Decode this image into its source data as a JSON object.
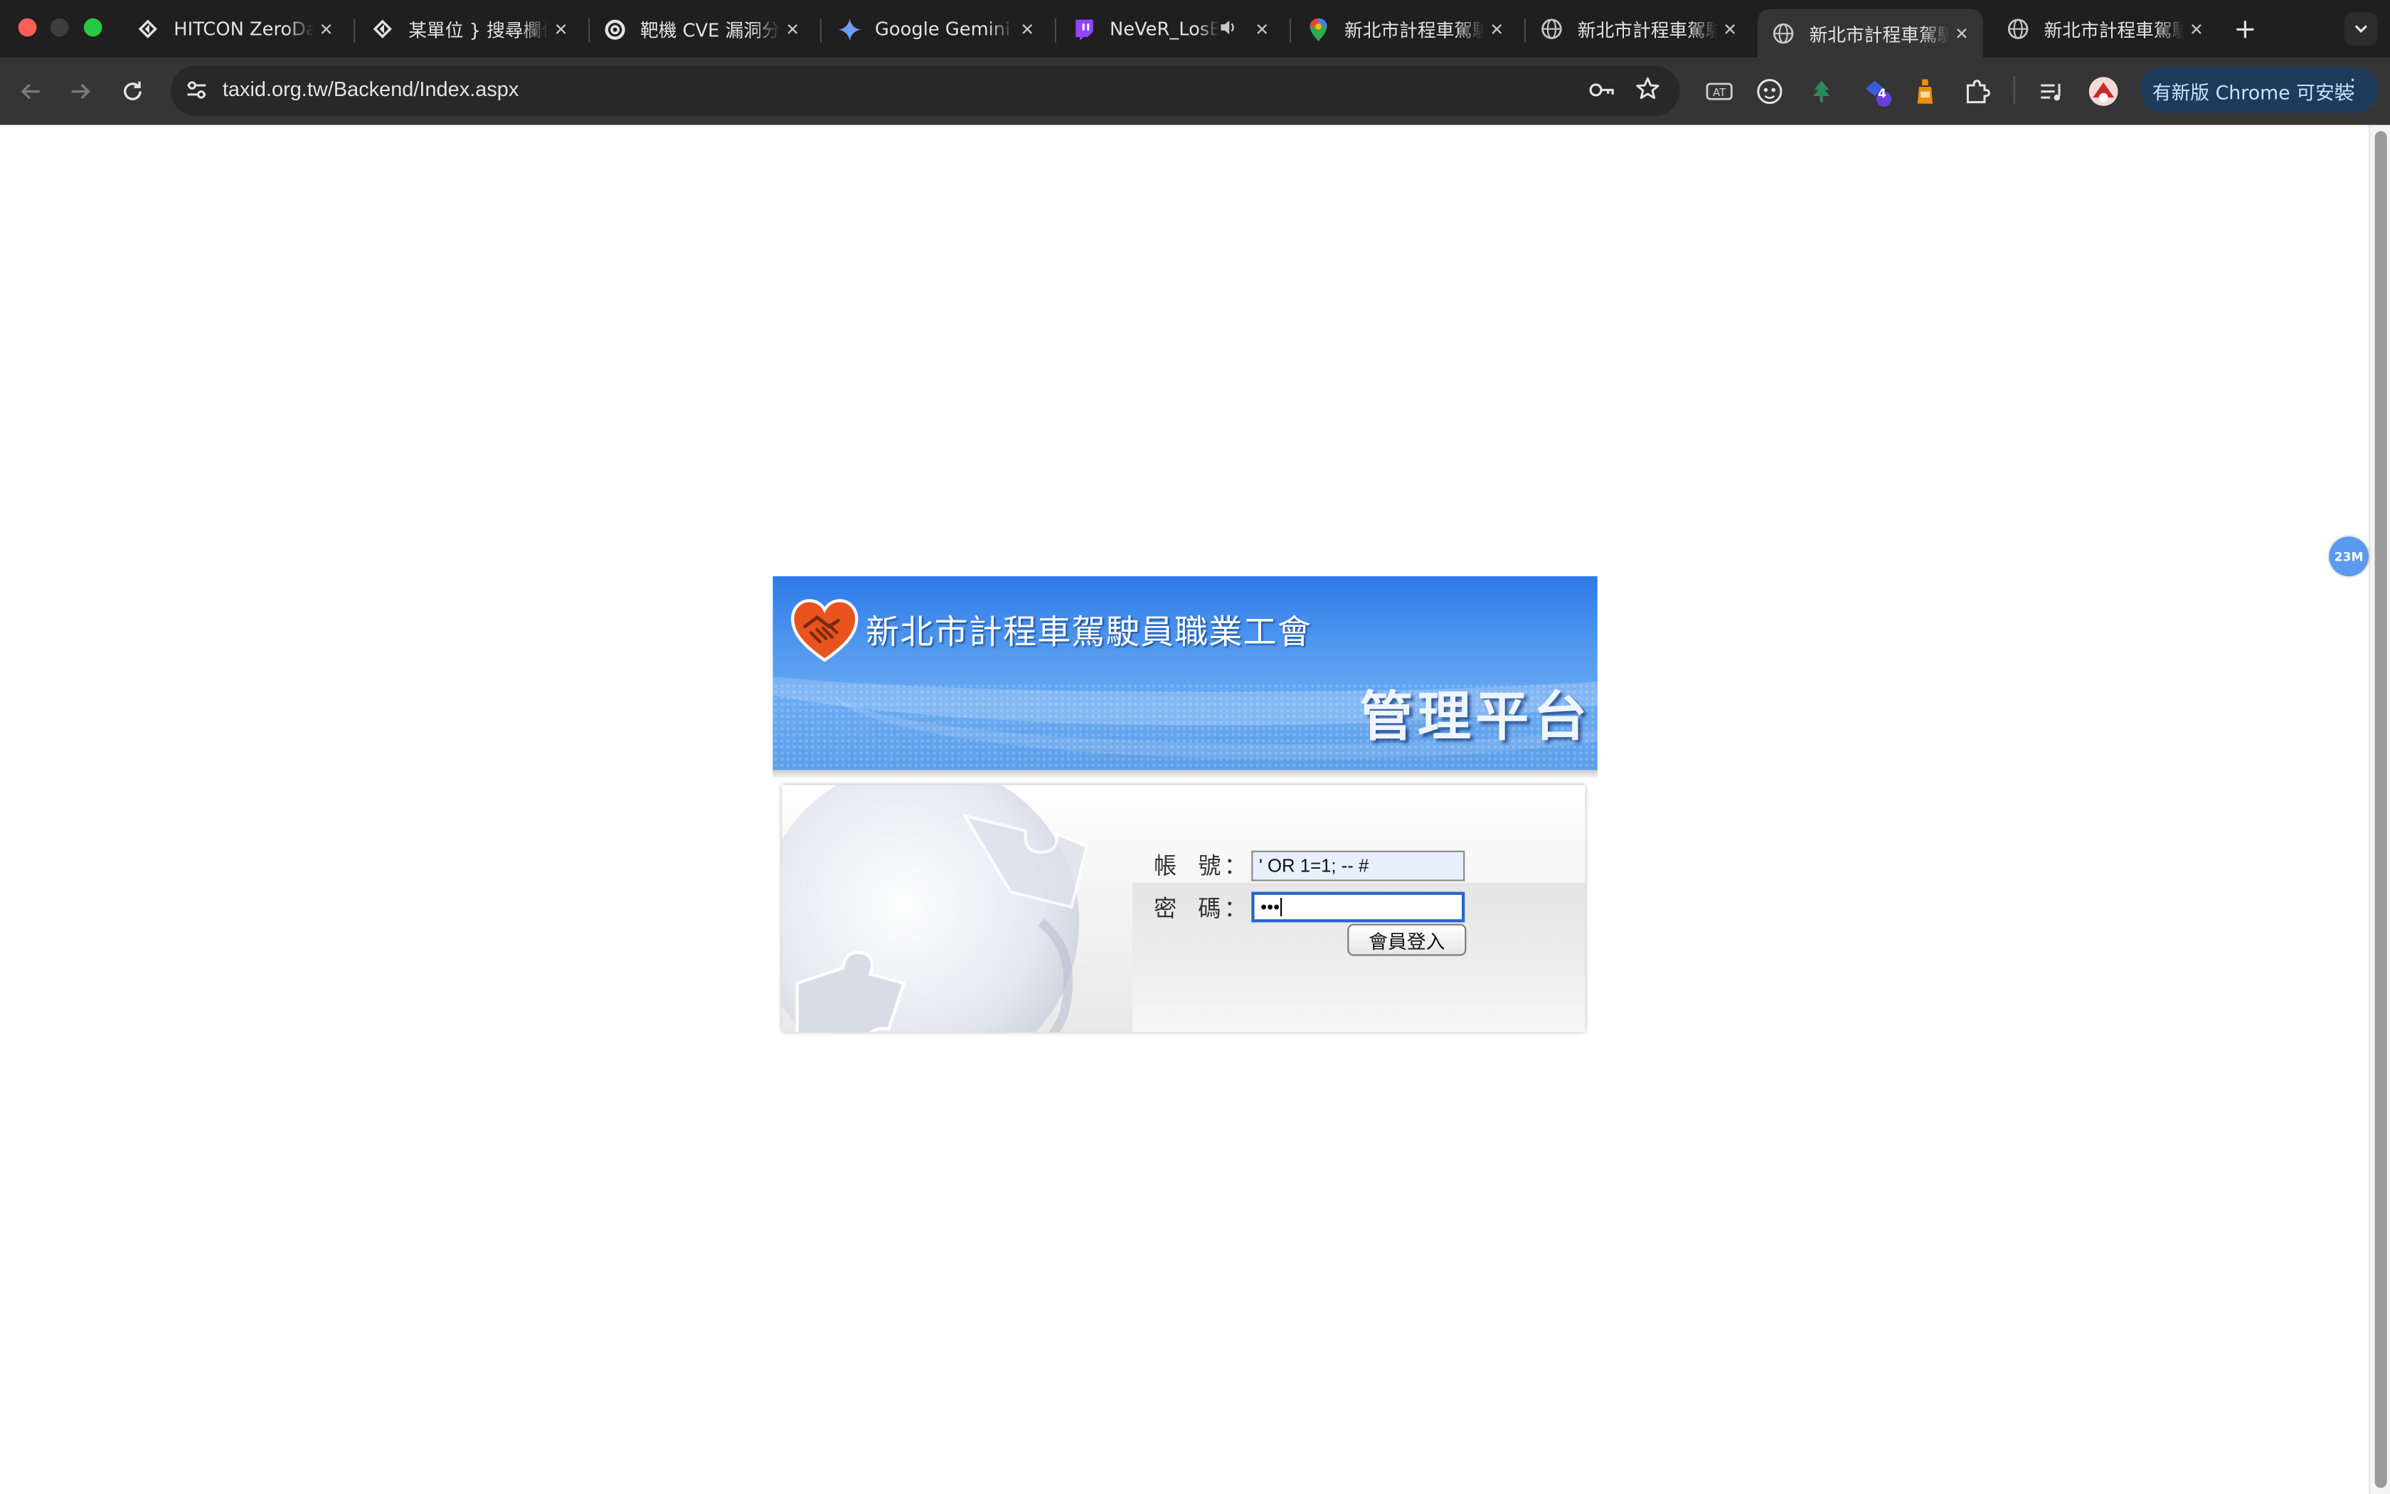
{
  "browser": {
    "tabs": [
      {
        "title": "HITCON ZeroDay",
        "icon": "hitcon-icon",
        "active": false
      },
      {
        "title": "某單位 } 搜尋欄位",
        "icon": "hitcon-icon",
        "active": false
      },
      {
        "title": "靶機 CVE 漏洞分析",
        "icon": "chatgpt-icon",
        "active": false
      },
      {
        "title": "Google Gemini",
        "icon": "gemini-icon",
        "active": false
      },
      {
        "title": "NeVeR_LosEr",
        "icon": "twitch-icon",
        "active": false,
        "audio": true
      },
      {
        "title": "新北市計程車駕駛員",
        "icon": "maps-pin-icon",
        "active": false
      },
      {
        "title": "新北市計程車駕駛員",
        "icon": "globe-icon",
        "active": false
      },
      {
        "title": "新北市計程車駕駛員",
        "icon": "globe-icon",
        "active": true
      },
      {
        "title": "新北市計程車駕駛員",
        "icon": "globe-icon",
        "active": false
      }
    ],
    "close_glyph": "✕",
    "new_tab_glyph": "+",
    "url": "taxid.org.tw/Backend/Index.aspx",
    "update_button": "有新版 Chrome 可安裝",
    "extension_badge": "4",
    "floating_badge": "23M"
  },
  "page": {
    "org_name": "新北市計程車駕駛員職業工會",
    "platform_title": "管理平台",
    "account_label": "帳號",
    "password_label": "密碼",
    "colon": "：",
    "account_value": "' OR 1=1; -- #",
    "password_value": "•••",
    "login_button": "會員登入"
  },
  "colors": {
    "banner_blue": "#4f97ef",
    "tabstrip_bg": "#1f1f1f",
    "toolbar_bg": "#353535",
    "update_button_bg": "#1f3b5c",
    "focus_ring": "#2a64c8"
  }
}
